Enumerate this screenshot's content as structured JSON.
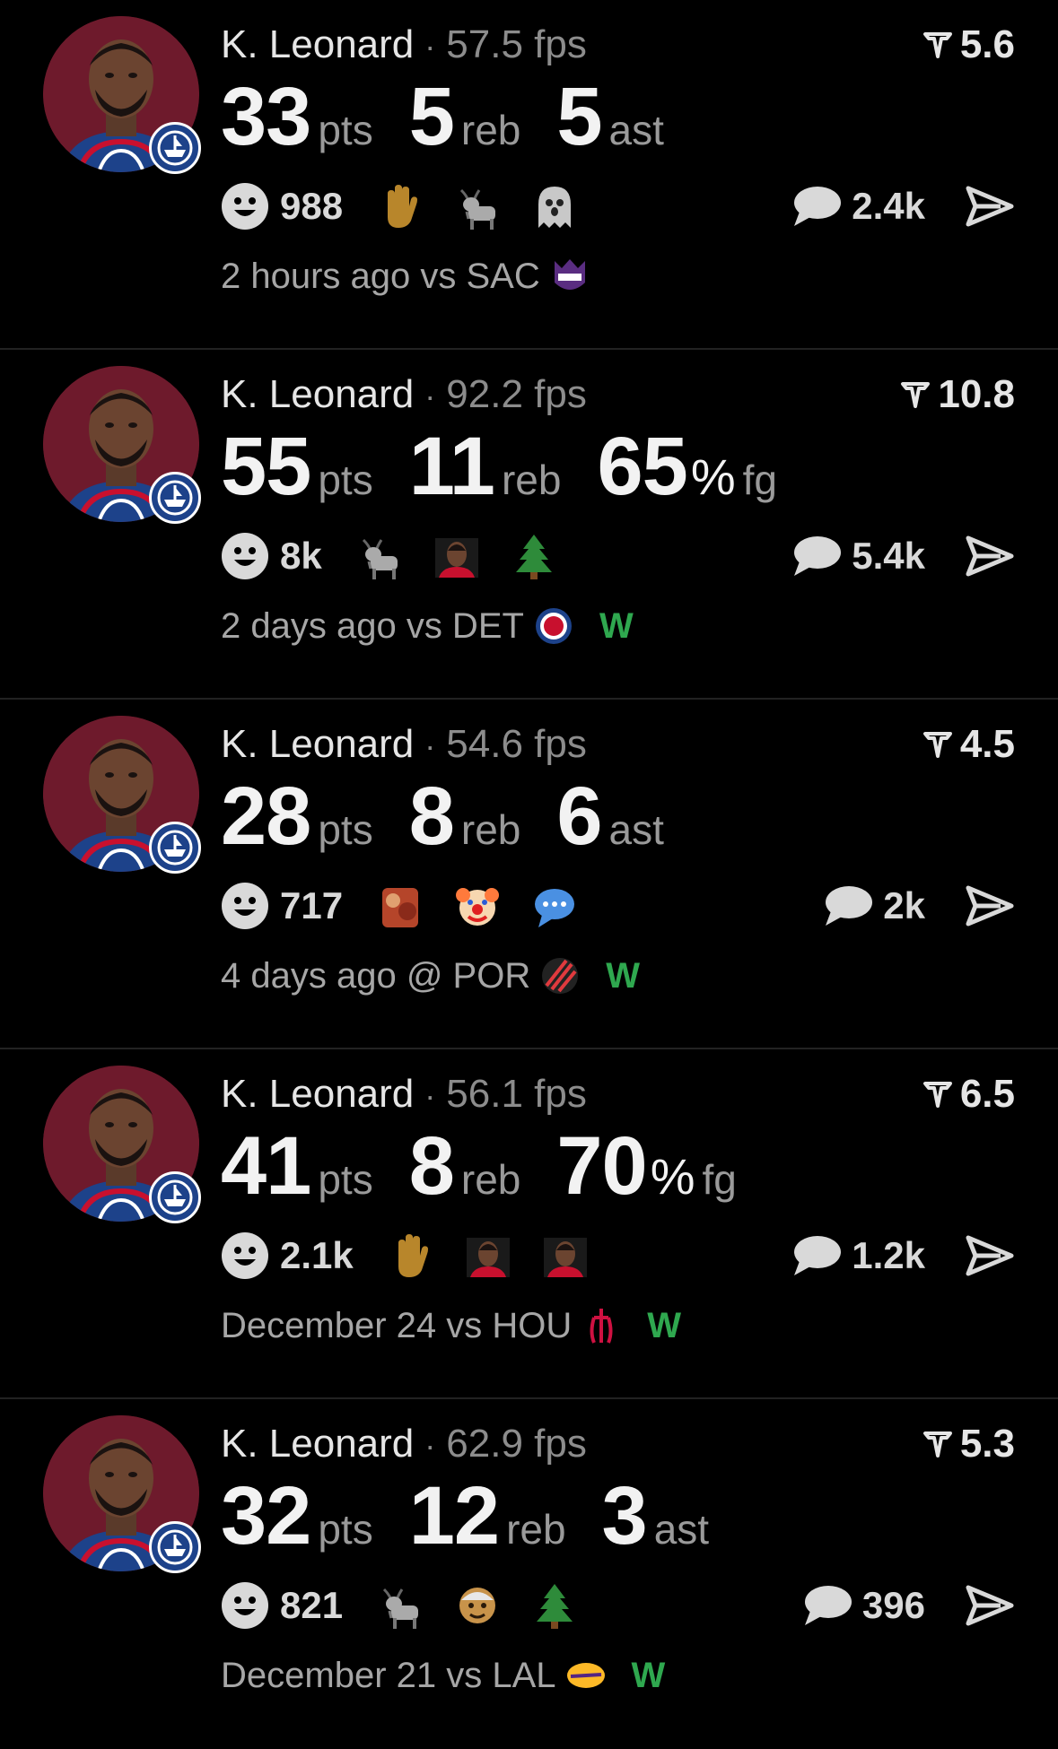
{
  "colors": {
    "win": "#2fa84f",
    "avatar_bg": "#6e1a2c",
    "text_muted": "#8c8c8c"
  },
  "icons": {
    "rating": "funnel-icon",
    "reactions": "smiley-icon",
    "comments": "speech-bubble-icon",
    "share": "send-arrow-icon"
  },
  "cards": [
    {
      "player": "K. Leonard",
      "fps": "57.5 fps",
      "rating": "5.6",
      "stats": [
        {
          "value": "33",
          "pct": "",
          "label": "pts"
        },
        {
          "value": "5",
          "pct": "",
          "label": "reb"
        },
        {
          "value": "5",
          "pct": "",
          "label": "ast"
        }
      ],
      "reaction_count": "988",
      "reaction_emojis": [
        "raised-hand",
        "goat",
        "ghost"
      ],
      "comment_count": "2.4k",
      "when": "2 hours ago vs SAC",
      "opponent_logo": "kings-logo",
      "result": ""
    },
    {
      "player": "K. Leonard",
      "fps": "92.2 fps",
      "rating": "10.8",
      "stats": [
        {
          "value": "55",
          "pct": "",
          "label": "pts"
        },
        {
          "value": "11",
          "pct": "",
          "label": "reb"
        },
        {
          "value": "65",
          "pct": "%",
          "label": "fg"
        }
      ],
      "reaction_count": "8k",
      "reaction_emojis": [
        "goat",
        "player-photo",
        "evergreen-tree"
      ],
      "comment_count": "5.4k",
      "when": "2 days ago vs DET",
      "opponent_logo": "pistons-logo",
      "result": "W"
    },
    {
      "player": "K. Leonard",
      "fps": "54.6 fps",
      "rating": "4.5",
      "stats": [
        {
          "value": "28",
          "pct": "",
          "label": "pts"
        },
        {
          "value": "8",
          "pct": "",
          "label": "reb"
        },
        {
          "value": "6",
          "pct": "",
          "label": "ast"
        }
      ],
      "reaction_count": "717",
      "reaction_emojis": [
        "sticker-image",
        "clown-face",
        "speech-balloon"
      ],
      "comment_count": "2k",
      "when": "4 days ago @ POR",
      "opponent_logo": "blazers-logo",
      "result": "W"
    },
    {
      "player": "K. Leonard",
      "fps": "56.1 fps",
      "rating": "6.5",
      "stats": [
        {
          "value": "41",
          "pct": "",
          "label": "pts"
        },
        {
          "value": "8",
          "pct": "",
          "label": "reb"
        },
        {
          "value": "70",
          "pct": "%",
          "label": "fg"
        }
      ],
      "reaction_count": "2.1k",
      "reaction_emojis": [
        "raised-hand",
        "player-photo",
        "player-photo"
      ],
      "comment_count": "1.2k",
      "when": "December 24 vs HOU",
      "opponent_logo": "rockets-logo",
      "result": "W"
    },
    {
      "player": "K. Leonard",
      "fps": "62.9 fps",
      "rating": "5.3",
      "stats": [
        {
          "value": "32",
          "pct": "",
          "label": "pts"
        },
        {
          "value": "12",
          "pct": "",
          "label": "reb"
        },
        {
          "value": "3",
          "pct": "",
          "label": "ast"
        }
      ],
      "reaction_count": "821",
      "reaction_emojis": [
        "goat",
        "older-person",
        "evergreen-tree"
      ],
      "comment_count": "396",
      "when": "December 21 vs LAL",
      "opponent_logo": "lakers-logo",
      "result": "W"
    }
  ]
}
